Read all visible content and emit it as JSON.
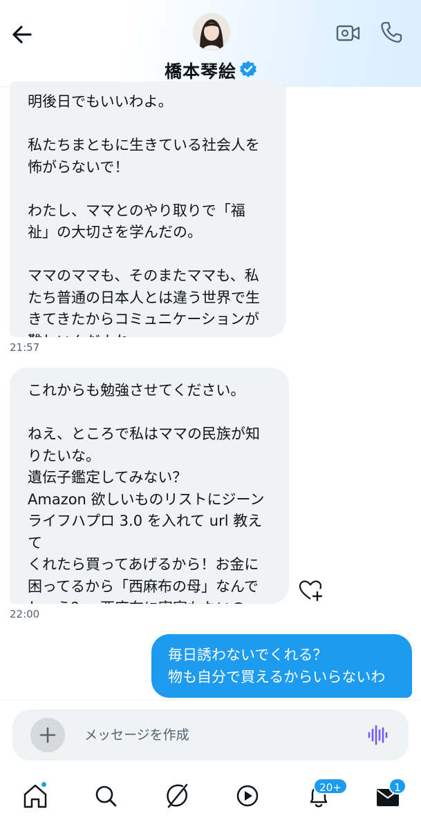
{
  "header": {
    "contact_name": "橋本琴絵",
    "verified": true,
    "back_icon": "arrow-left-icon",
    "video_icon": "video-call-icon",
    "call_icon": "phone-icon",
    "accent_color": "#1d9bf0"
  },
  "messages": [
    {
      "direction": "incoming",
      "text": "明後日でもいいわよ。\n\n私たちまともに生きている社会人を\n怖がらないで！\n\nわたし、ママとのやり取りで「福\n祉」の大切さを学んだの。\n\nママのママも、そのまたママも、私\nたち普通の日本人とは違う世界で生\nきてきたからコミュニケーションが\n難しいんだよね。",
      "timestamp": "21:57"
    },
    {
      "direction": "incoming",
      "text": "これからも勉強させてください。\n\nねえ、ところで私はママの民族が知\nりたいな。\n遺伝子鑑定してみない？\nAmazon 欲しいものリストにジーン\nライフハプロ 3.0 を入れて url 教えて\nくれたら買ってあげるから！お金に\n困ってるから「西麻布の母」なんで\nしょう？　西麻布に実家もないの\nに。",
      "timestamp": "22:00"
    },
    {
      "direction": "outgoing",
      "text": "毎日誘わないでくれる？\n物も自分で買えるからいらないわ"
    }
  ],
  "composer": {
    "placeholder": "メッセージを作成",
    "value": ""
  },
  "bottom_nav": {
    "items": [
      "home-icon",
      "search-icon",
      "grok-icon",
      "video-play-icon",
      "notifications-icon",
      "messages-icon"
    ],
    "notifications_badge": "20+",
    "messages_badge": "1"
  }
}
